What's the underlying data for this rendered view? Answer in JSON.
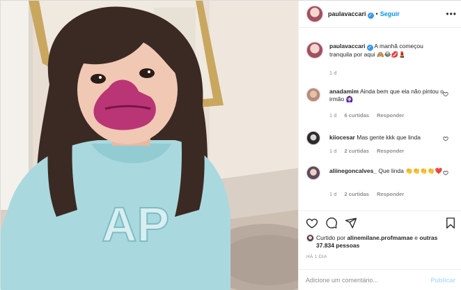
{
  "header": {
    "username": "paulavaccari",
    "separator": "•",
    "follow_label": "Seguir",
    "more_label": "•••"
  },
  "caption": {
    "username": "paulavaccari",
    "text": "A manhã começou tranquila por aqui 🙈😂💋💄",
    "time": "1 d"
  },
  "comments": [
    {
      "username": "anadamim",
      "text": "Ainda bem que ela não pintou o irmão 🙆🏻‍♀️",
      "time": "1 d",
      "likes": "6 curtidas",
      "reply": "Responder"
    },
    {
      "username": "kiiocesar",
      "text": "Mas gente kkk que linda",
      "time": "1 d",
      "likes": "2 curtidas",
      "reply": "Responder"
    },
    {
      "username": "aliinegoncalves_",
      "text": "Que linda 👏👏👏👏❤️",
      "time": "1 d",
      "likes": "2 curtidas",
      "reply": "Responder"
    }
  ],
  "likes": {
    "prefix": "Curtido por",
    "user": "alinemilane.profmamae",
    "connector": "e",
    "others": "outras 37.834 pessoas"
  },
  "timestamp": "HÁ 1 DIA",
  "add_comment": {
    "placeholder": "Adicione um comentário...",
    "publish_label": "Publicar"
  },
  "icons": {
    "like": "heart-icon",
    "comment": "comment-icon",
    "share": "share-icon",
    "save": "bookmark-icon",
    "comment_like": "heart-icon",
    "verified": "verified-badge-icon"
  },
  "colors": {
    "link_blue": "#0095f6",
    "verified_blue": "#3897f0",
    "muted": "#8e8e8e",
    "publish_disabled": "#b2dffc"
  }
}
